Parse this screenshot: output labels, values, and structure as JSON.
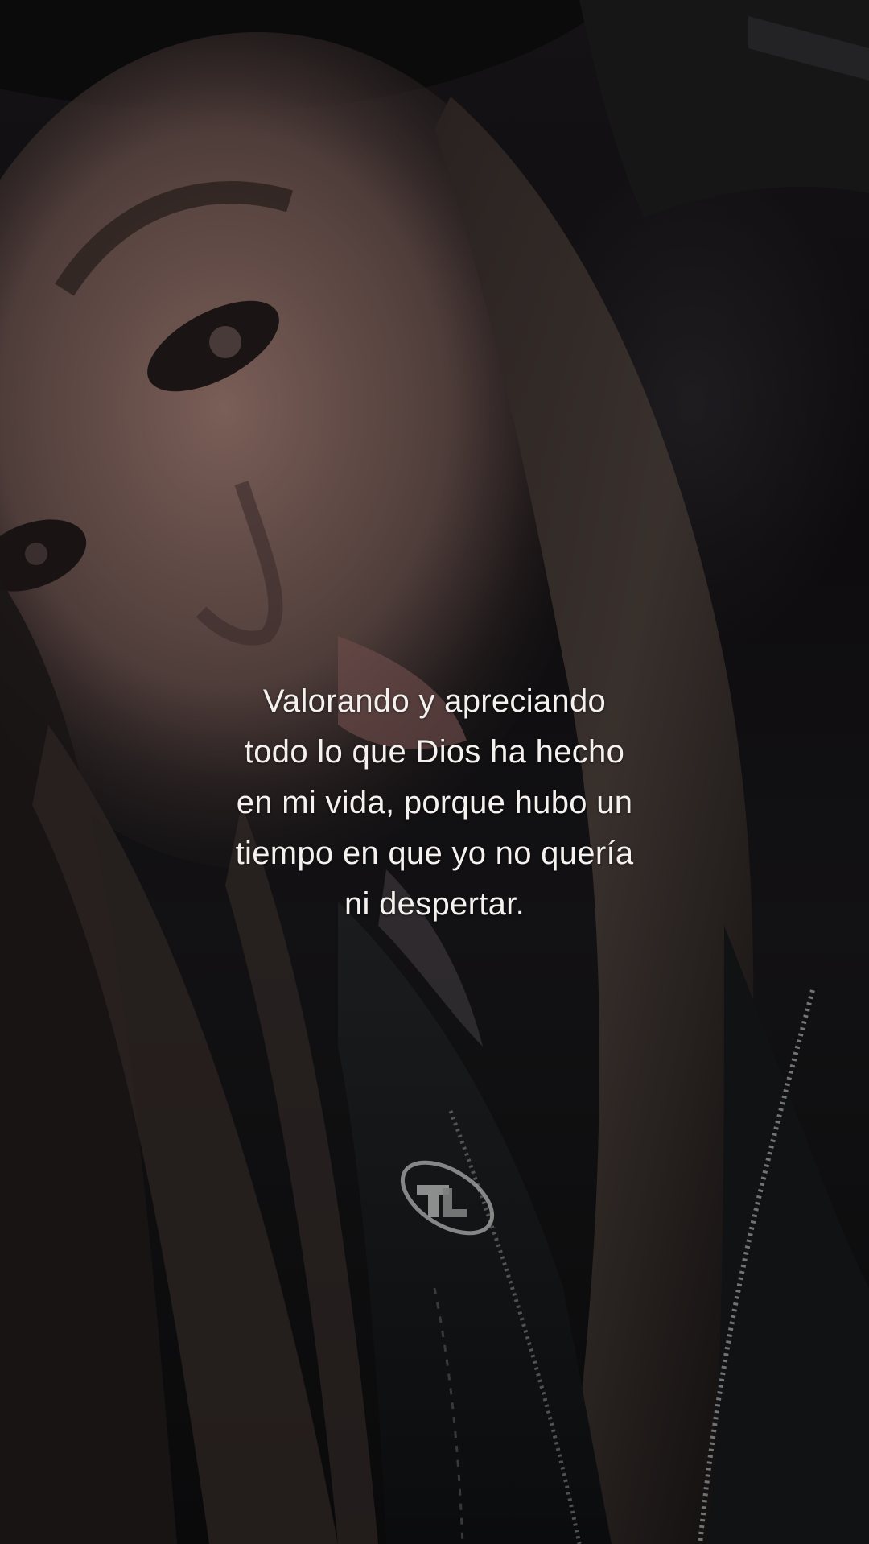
{
  "overlay": {
    "lines": [
      "Valorando y apreciando",
      "todo lo que Dios ha hecho",
      "en mi vida, porque hubo un",
      "tiempo en que yo no quería",
      "ni despertar."
    ]
  },
  "logo": {
    "icon": "tl-watermark-logo",
    "color": "#9a9a9a"
  },
  "colors": {
    "text": "#f4f1ee",
    "background": "#0b0a0c"
  }
}
